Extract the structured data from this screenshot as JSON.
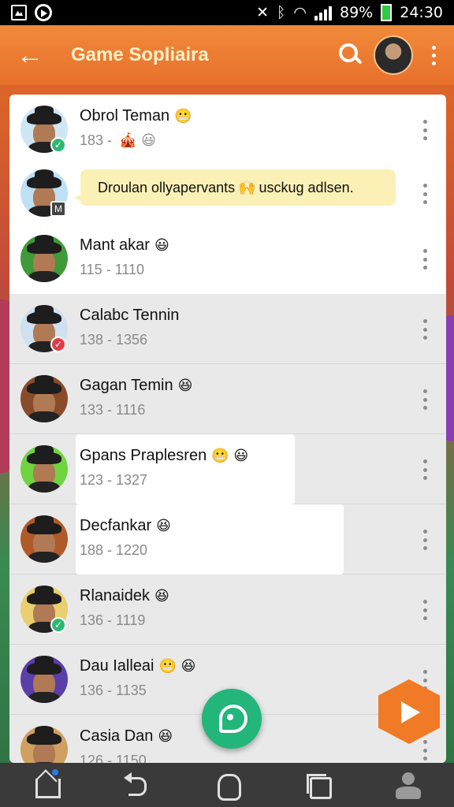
{
  "status_bar": {
    "battery": "89%",
    "time": "24:30"
  },
  "app_bar": {
    "back_glyph": "←",
    "title": "Game Sopliaira",
    "icons": [
      "search-icon",
      "profile-avatar",
      "more-vertical-icon"
    ]
  },
  "chats": [
    {
      "name": "Obrol Teman",
      "emoji": "😬",
      "sub": "183 - ",
      "sub_emoji": "🎪 😃",
      "badge": "check",
      "shaded": false
    },
    {
      "name": "",
      "bubble": "Droulan ollyapervants",
      "bubble_emoji": "🙌",
      "bubble_tail": "usckug adlsen.",
      "badge": "tag",
      "shaded": false
    },
    {
      "name": "Mant akar",
      "emoji": "😃",
      "sub": "115 - 1110",
      "badge": "",
      "shaded": false
    },
    {
      "name": "Calabc Tennin",
      "emoji": "",
      "sub": "138 - 1356",
      "badge": "check-red",
      "shaded": true
    },
    {
      "name": "Gagan Temin",
      "emoji": "😆",
      "sub": "133 - 1116",
      "badge": "",
      "shaded": true
    },
    {
      "name": "Gpans Praplesren",
      "emoji": "😬 😃",
      "sub": "123 - 1327",
      "badge": "",
      "shaded": true
    },
    {
      "name": "Decfankar",
      "emoji": "😆",
      "sub": "188 - 1220",
      "badge": "",
      "shaded": true
    },
    {
      "name": "Rlanaidek",
      "emoji": "😆",
      "sub": "136 - 1119",
      "badge": "check",
      "shaded": true
    },
    {
      "name": "Dau Ialleai",
      "emoji": "😬 😆",
      "sub": "136 - 1135",
      "badge": "",
      "shaded": true
    },
    {
      "name": "Casia Dan",
      "emoji": "😆",
      "sub": "126 - 1150",
      "badge": "",
      "shaded": true
    }
  ],
  "colors": {
    "app_bar": "#e8702c",
    "title_text": "#fdf0c8",
    "fab_chat": "#22b67a",
    "fab_play": "#f07a26",
    "badge_green": "#2eb872",
    "badge_red": "#e23b4a",
    "bubble": "#fbf0b6"
  },
  "nav_bar": {
    "icons": [
      "home-icon",
      "back-icon",
      "home-circle-icon",
      "recents-icon",
      "profile-icon"
    ]
  }
}
